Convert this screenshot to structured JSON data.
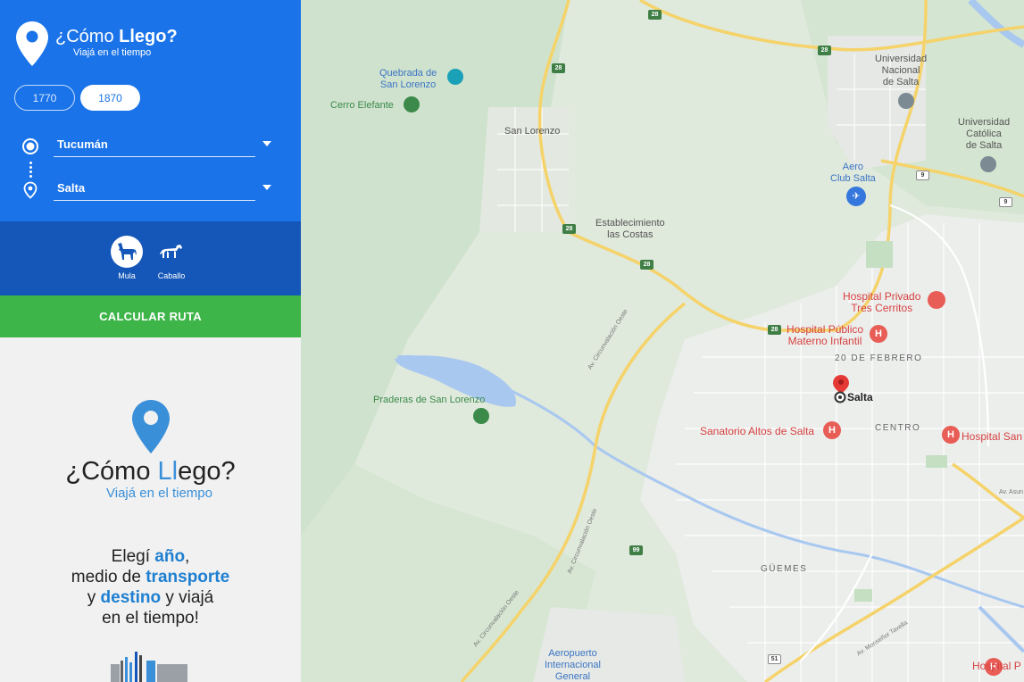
{
  "app": {
    "title_prefix": "¿Cómo ",
    "title_bold": "Llego?",
    "subtitle": "Viajá en el tiempo"
  },
  "years": [
    {
      "label": "1770",
      "selected": false
    },
    {
      "label": "1870",
      "selected": true
    }
  ],
  "route": {
    "origin": "Tucumán",
    "destination": "Salta"
  },
  "transport": [
    {
      "label": "Mula",
      "selected": true
    },
    {
      "label": "Caballo",
      "selected": false
    }
  ],
  "calculate_label": "CALCULAR RUTA",
  "logo": {
    "title_prefix": "¿Cómo ",
    "title_l": "Ll",
    "title_rest": "ego?",
    "subtitle": "Viajá en el tiempo"
  },
  "promo": {
    "line1_a": "Elegí ",
    "line1_hl": "año",
    "line1_b": ",",
    "line2_a": "medio de ",
    "line2_hl": "transporte",
    "line3_a": "y ",
    "line3_hl": "destino",
    "line3_b": " y viajá",
    "line4": "en el tiempo!"
  },
  "map": {
    "labels": {
      "quebrada": "Quebrada de\nSan Lorenzo",
      "cerro": "Cerro Elefante",
      "san_lorenzo": "San Lorenzo",
      "establecimiento": "Establecimiento\nlas Costas",
      "praderas": "Praderas de San Lorenzo",
      "universidad_nacional": "Universidad\nNacional\nde Salta",
      "universidad_catolica": "Universidad\nCatólica\nde Salta",
      "aero_club": "Aero\nClub Salta",
      "hospital_privado": "Hospital Privado\nTres Cerritos",
      "hospital_publico": "Hospital Público\nMaterno Infantil",
      "veinte_febrero": "20 DE FEBRERO",
      "salta": "Salta",
      "centro": "CENTRO",
      "sanatorio": "Sanatorio Altos de Salta",
      "hospital_san": "Hospital San",
      "guemes": "GÜEMES",
      "aeropuerto": "Aeropuerto\nInternacional\nGeneral",
      "hospital_p": "Hospital P",
      "circ_oeste_1": "Av. Circunvalación Oeste",
      "circ_oeste_2": "Av. Circunvalación Oeste",
      "circ_oeste_3": "Av. Circunvalación Oeste",
      "monsenor": "Av. Monseñor Tavella",
      "av_asun": "Av. Asun"
    },
    "shields": {
      "r28a": "28",
      "r28b": "28",
      "r28c": "28",
      "r28d": "28",
      "r28e": "28",
      "r28f": "28",
      "r9a": "9",
      "r9b": "9",
      "r99": "99",
      "r51": "51"
    }
  },
  "colors": {
    "primary_blue": "#1a73e8",
    "dark_blue": "#1557b8",
    "green_button": "#3db548",
    "accent_blue": "#3a8fd9"
  }
}
